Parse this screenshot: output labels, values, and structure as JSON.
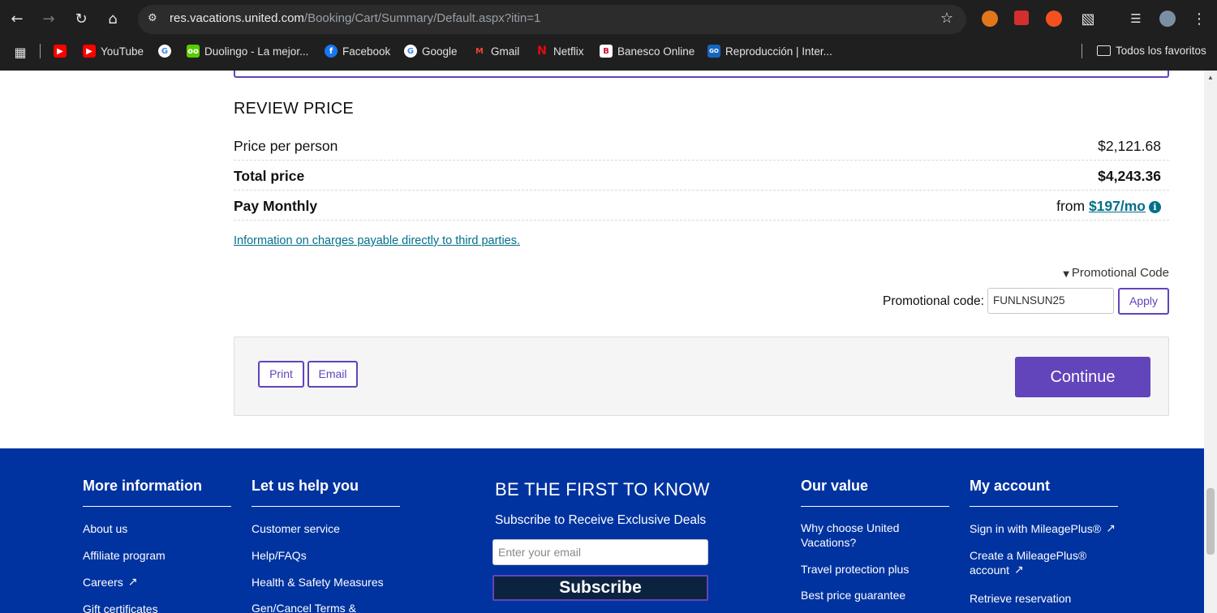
{
  "browser": {
    "url_host": "res.vacations.united.com",
    "url_path": "/Booking/Cart/Summary/Default.aspx?itin=1",
    "bookmarks": [
      {
        "label": "",
        "icon": "youtube-icon"
      },
      {
        "label": "YouTube",
        "icon": "youtube-icon"
      },
      {
        "label": "",
        "icon": "google-icon"
      },
      {
        "label": "Duolingo - La mejor...",
        "icon": "duolingo-icon"
      },
      {
        "label": "Facebook",
        "icon": "facebook-icon"
      },
      {
        "label": "Google",
        "icon": "google-icon"
      },
      {
        "label": "Gmail",
        "icon": "gmail-icon"
      },
      {
        "label": "Netflix",
        "icon": "netflix-icon"
      },
      {
        "label": "Banesco Online",
        "icon": "banesco-icon"
      },
      {
        "label": "Reproducción | Inter...",
        "icon": "inter-icon"
      }
    ],
    "all_bookmarks_label": "Todos los favoritos"
  },
  "review": {
    "title": "REVIEW PRICE",
    "price_per_person_label": "Price per person",
    "price_per_person_value": "$2,121.68",
    "total_label": "Total price",
    "total_value": "$4,243.36",
    "pay_monthly_label": "Pay Monthly",
    "pay_monthly_prefix": "from",
    "pay_monthly_value": "$197/mo",
    "third_party_link": "Information on charges payable directly to third parties.",
    "promo_toggle": "Promotional Code",
    "promo_label": "Promotional code:",
    "promo_value": "FUNLNSUN25",
    "apply_label": "Apply",
    "print_label": "Print",
    "email_label": "Email",
    "continue_label": "Continue"
  },
  "footer": {
    "more_info": {
      "heading": "More information",
      "links": [
        "About us",
        "Affiliate program",
        "Careers",
        "Gift certificates"
      ]
    },
    "help": {
      "heading": "Let us help you",
      "links": [
        "Customer service",
        "Help/FAQs",
        "Health & Safety Measures",
        "Gen/Cancel Terms &"
      ]
    },
    "newsletter": {
      "title": "BE THE FIRST TO KNOW",
      "subtitle": "Subscribe to Receive Exclusive Deals",
      "placeholder": "Enter your email",
      "button": "Subscribe"
    },
    "value": {
      "heading": "Our value",
      "links": [
        "Why choose United Vacations?",
        "Travel protection plus",
        "Best price guarantee"
      ]
    },
    "account": {
      "heading": "My account",
      "links": [
        "Sign in with MileagePlus®",
        "Create a MileagePlus® account",
        "Retrieve reservation"
      ]
    }
  },
  "colors": {
    "brand_purple": "#6244bb",
    "footer_blue": "#0033a0",
    "link_teal": "#00708a"
  }
}
